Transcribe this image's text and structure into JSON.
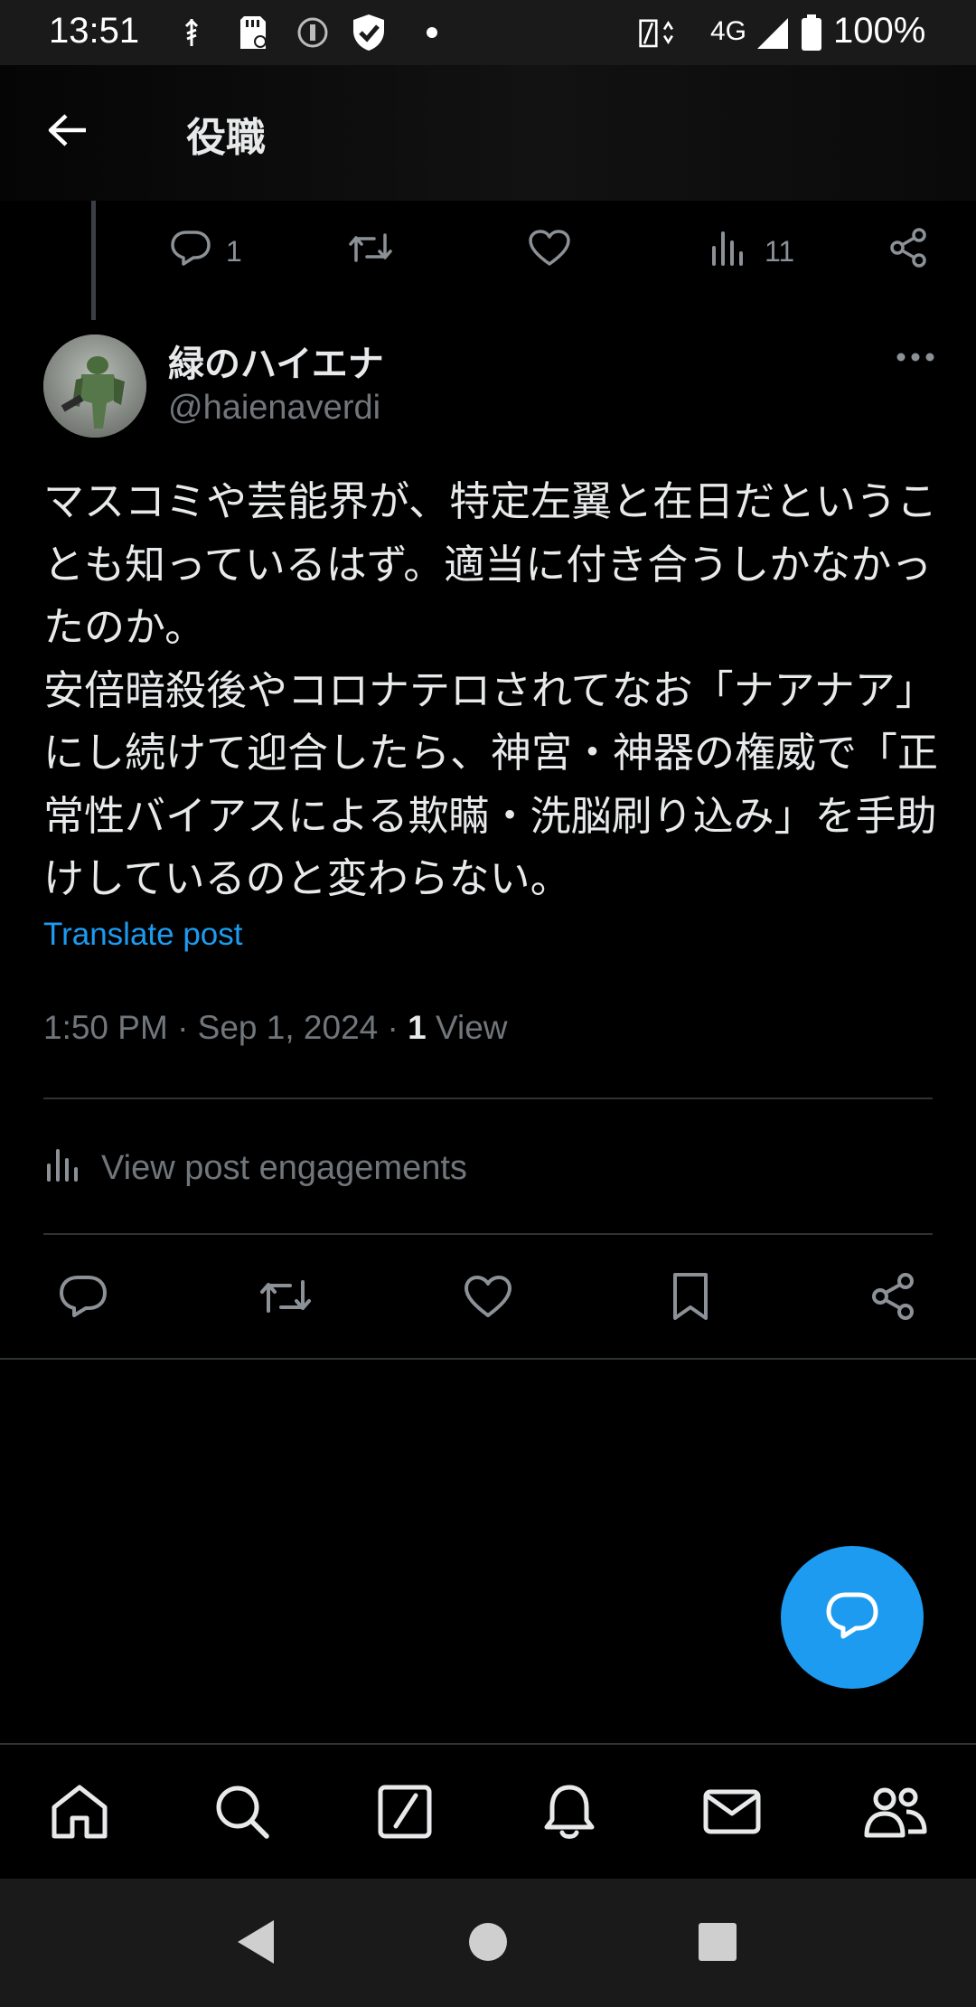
{
  "status_bar": {
    "time": "13:51",
    "network": "4G",
    "battery": "100%",
    "icons": [
      "usb-icon",
      "sd-card-icon",
      "vpn-info-icon",
      "shield-check-icon",
      "dot-icon",
      "data-saver-icon",
      "signal-icon",
      "battery-icon"
    ]
  },
  "header": {
    "title": "役職",
    "back_icon": "arrow-left-icon"
  },
  "parent_post_actions": {
    "reply_count": "1",
    "repost_count": "",
    "like_count": "",
    "views_count": "11"
  },
  "post": {
    "author_name": "緑のハイエナ",
    "author_handle": "@haienaverdi",
    "text": "マスコミや芸能界が、特定左翼と在日だということも知っているはず。適当に付き合うしかなかったのか。\n安倍暗殺後やコロナテロされてなお「ナアナア」にし続けて迎合したら、神宮・神器の権威で「正常性バイアスによる欺瞞・洗脳刷り込み」を手助けしているのと変わらない。",
    "translate_label": "Translate post",
    "timestamp": "1:50 PM · Sep 1, 2024 · ",
    "views_number": "1",
    "views_label": " View",
    "engagements_label": "View post engagements"
  },
  "colors": {
    "background": "#000000",
    "accent": "#1d9bf0",
    "secondary_text": "#71767b",
    "divider": "#2f3336"
  },
  "bottom_nav": {
    "items": [
      "home-icon",
      "search-icon",
      "grok-icon",
      "notifications-icon",
      "messages-icon",
      "communities-icon"
    ]
  },
  "system_nav": {
    "items": [
      "back-triangle-icon",
      "home-circle-icon",
      "recents-square-icon"
    ]
  }
}
